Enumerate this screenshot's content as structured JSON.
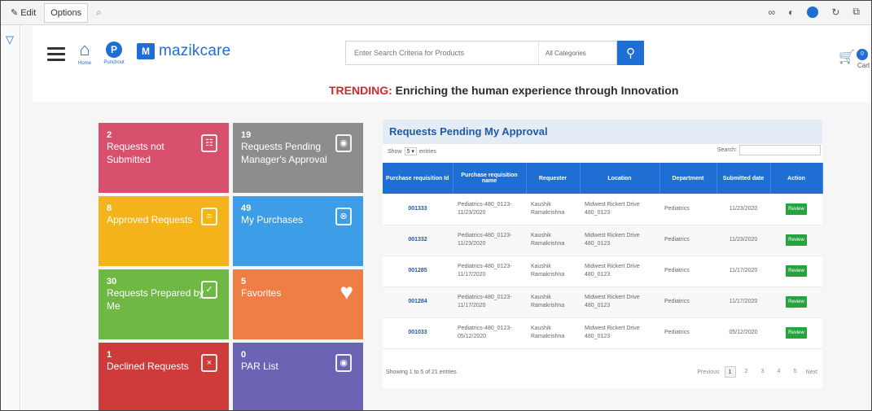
{
  "toolbar": {
    "edit_label": "Edit",
    "options_label": "Options"
  },
  "header": {
    "home_label": "Home",
    "punchout_label": "Punchout",
    "punchout_letter": "P",
    "logo_mark": "M",
    "logo_text": "mazikcare",
    "search": {
      "placeholder": "Enter Search Criteria for Products",
      "category": "All Categories"
    },
    "cart": {
      "count": "0",
      "label": "Cart"
    }
  },
  "trending": {
    "key": "TRENDING:",
    "text": " Enriching the human experience through Innovation"
  },
  "tiles": [
    {
      "count": "2",
      "label": "Requests not Submitted",
      "color": "#d9506e",
      "icon": "cart-icon"
    },
    {
      "count": "19",
      "label": "Requests Pending Manager's Approval",
      "color": "#8d8d8d",
      "icon": "approval-icon"
    },
    {
      "count": "8",
      "label": "Approved Requests",
      "color": "#f5b31b",
      "icon": "document-icon"
    },
    {
      "count": "49",
      "label": "My Purchases",
      "color": "#3d9de6",
      "icon": "purchases-icon"
    },
    {
      "count": "30",
      "label": "Requests Prepared by Me",
      "color": "#6eb843",
      "icon": "checklist-icon"
    },
    {
      "count": "5",
      "label": "Favorites",
      "color": "#ef7e45",
      "icon": "heart-icon"
    },
    {
      "count": "1",
      "label": "Declined Requests",
      "color": "#cf3a3a",
      "icon": "declined-icon"
    },
    {
      "count": "0",
      "label": "PAR List",
      "color": "#6c63b5",
      "icon": "par-list-icon"
    }
  ],
  "approvals": {
    "title": "Requests Pending My Approval",
    "show_label": "Show",
    "show_value": "5",
    "entries_label": "entries",
    "search_label": "Search:",
    "columns": [
      "Purchase requisition Id",
      "Purchase requisition name",
      "Requester",
      "Location",
      "Department",
      "Submitted date",
      "Action"
    ],
    "rows": [
      {
        "id": "001333",
        "name": "Pediatrics-480_0123-11/23/2020",
        "requester": "Kaushik Ramakrishna",
        "location": "Midwest Rickert Drive 480_0123",
        "department": "Pediatrics",
        "date": "11/23/2020",
        "action": "Review"
      },
      {
        "id": "001332",
        "name": "Pediatrics-480_0123-11/23/2020",
        "requester": "Kaushik Ramakrishna",
        "location": "Midwest Rickert Drive 480_0123",
        "department": "Pediatrics",
        "date": "11/23/2020",
        "action": "Review"
      },
      {
        "id": "001285",
        "name": "Pediatrics-480_0123-11/17/2020",
        "requester": "Kaushik Ramakrishna",
        "location": "Midwest Rickert Drive 480_0123",
        "department": "Pediatrics",
        "date": "11/17/2020",
        "action": "Review"
      },
      {
        "id": "001284",
        "name": "Pediatrics-480_0123-11/17/2020",
        "requester": "Kaushik Ramakrishna",
        "location": "Midwest Rickert Drive 480_0123",
        "department": "Pediatrics",
        "date": "11/17/2020",
        "action": "Review"
      },
      {
        "id": "001033",
        "name": "Pediatrics-480_0123-05/12/2020",
        "requester": "Kaushik Ramakrishna",
        "location": "Midwest Rickert Drive 480_0123",
        "department": "Pediatrics",
        "date": "05/12/2020",
        "action": "Review"
      }
    ],
    "footer_info": "Showing 1 to 5 of 21 entries",
    "pagination": {
      "previous": "Previous",
      "pages": [
        "1",
        "2",
        "3",
        "4",
        "5"
      ],
      "next": "Next",
      "current": "1"
    }
  }
}
